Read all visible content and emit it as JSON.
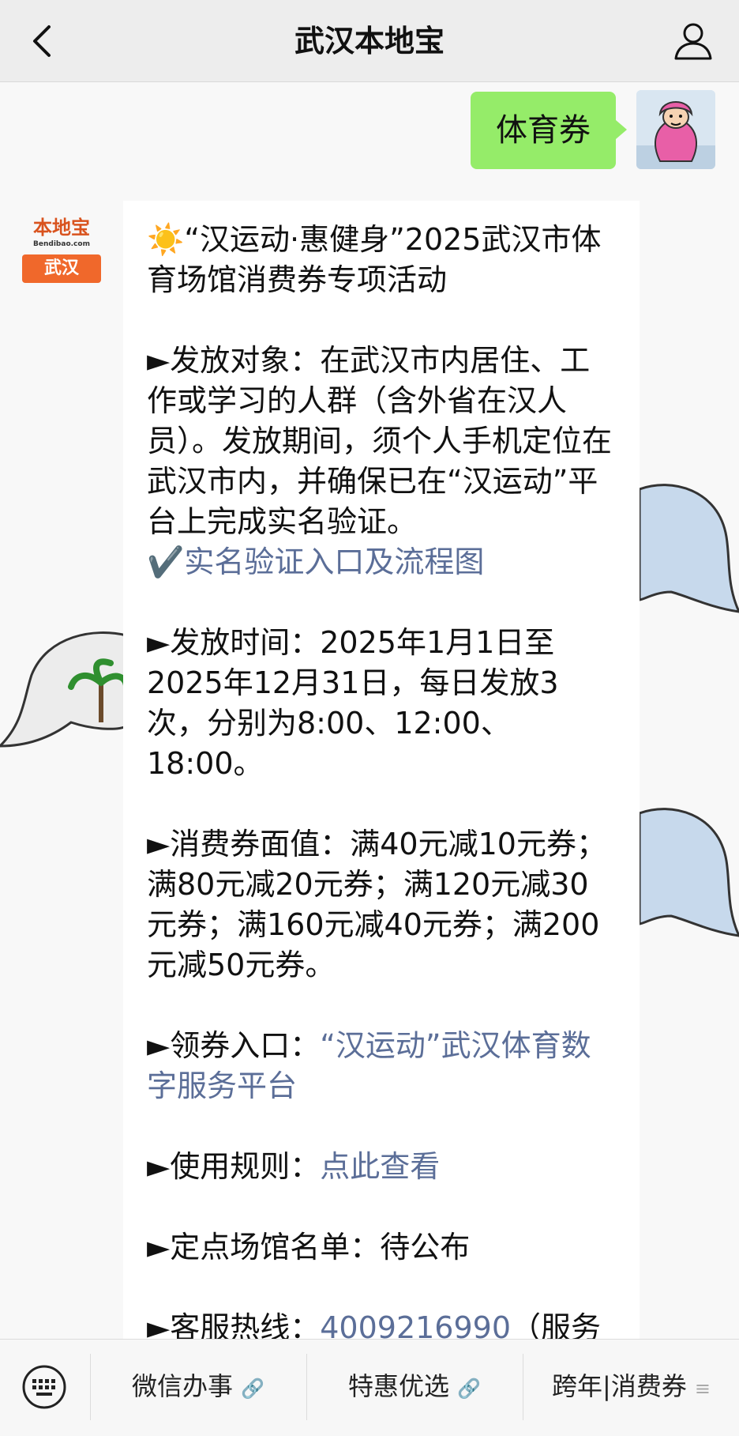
{
  "header": {
    "title": "武汉本地宝"
  },
  "outgoing_message": "体育券",
  "bot": {
    "avatar_brand": "本地宝",
    "avatar_sub": "Bendibao.com",
    "avatar_city": "武汉"
  },
  "message": {
    "title_emoji": "☀️",
    "title": "“汉运动·惠健身”2025武汉市体育场馆消费券专项活动",
    "target_label": "►发放对象：",
    "target_text": "在武汉市内居住、工作或学习的人群（含外省在汉人员）。发放期间，须个人手机定位在武汉市内，并确保已在“汉运动”平台上完成实名验证。",
    "verify_prefix": "✔️",
    "verify_link": "实名验证入口及流程图",
    "time_label": "►发放时间：",
    "time_text": "2025年1月1日至2025年12月31日，每日发放3次，分别为8:00、12:00、18:00。",
    "value_label": "►消费券面值：",
    "value_text": "满40元减10元券；满80元减20元券；满120元减30元券；满160元减40元券；满200元减50元券。",
    "entry_label": "►领券入口：",
    "entry_link": "“汉运动”武汉体育数字服务平台",
    "rules_label": "►使用规则：",
    "rules_link": "点此查看",
    "venues_label": "►定点场馆名单：",
    "venues_text": "待公布",
    "hotline_label": "►客服热线：",
    "hotline_number": "4009216990",
    "hotline_suffix": "（服务"
  },
  "toolbar": {
    "item1": "微信办事",
    "item2": "特惠优选",
    "item3": "跨年|消费券"
  },
  "colors": {
    "outgoing_bubble": "#95ec69",
    "link": "#5b6e98",
    "brand_orange": "#f0682b"
  }
}
